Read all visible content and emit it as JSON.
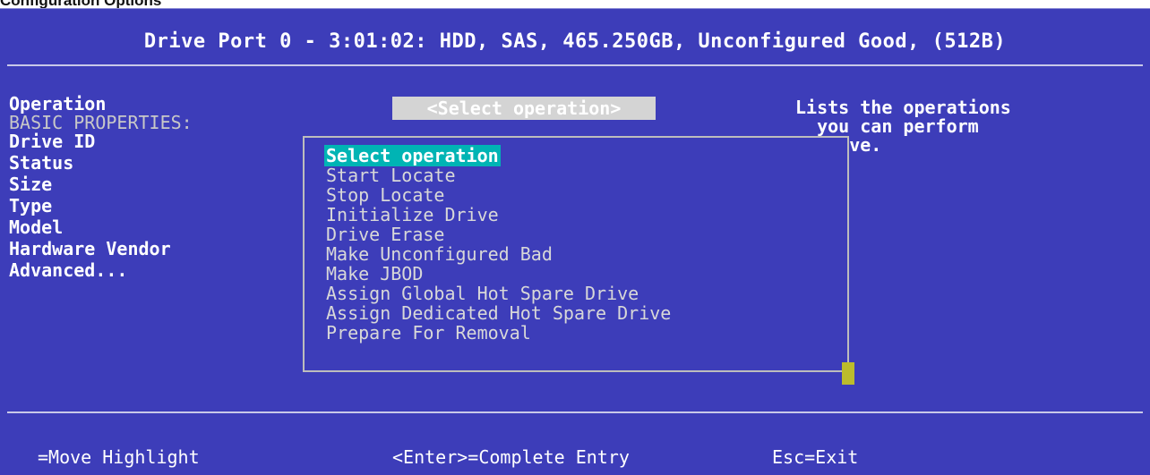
{
  "top_fragment": "Configuration Options",
  "title": "Drive Port 0 - 3:01:02: HDD, SAS, 465.250GB, Unconfigured Good, (512B)",
  "form": {
    "operation_label": "Operation",
    "operation_value": "<Select operation>",
    "basic_properties_label": "BASIC PROPERTIES:",
    "fields": [
      "Drive ID",
      "Status",
      "Size",
      "Type",
      "Model",
      "Hardware Vendor",
      "Advanced..."
    ]
  },
  "help_text": "Lists the operations\n  you can perform\n  drive.",
  "dropdown": {
    "selected_index": 0,
    "options": [
      "Select operation",
      "Start Locate",
      "Stop Locate",
      "Initialize Drive",
      "Drive Erase",
      "Make Unconfigured Bad",
      "Make JBOD",
      "Assign Global Hot Spare Drive",
      "Assign Dedicated Hot Spare Drive",
      "Prepare For Removal"
    ]
  },
  "footer": {
    "move": "=Move Highlight",
    "enter": "<Enter>=Complete Entry",
    "esc": "Esc=Exit"
  },
  "colors": {
    "background": "#3d3db9",
    "highlight": "#00b4b4",
    "scrollbar": "#bcbc2c",
    "value_box": "#d4d4d4"
  }
}
